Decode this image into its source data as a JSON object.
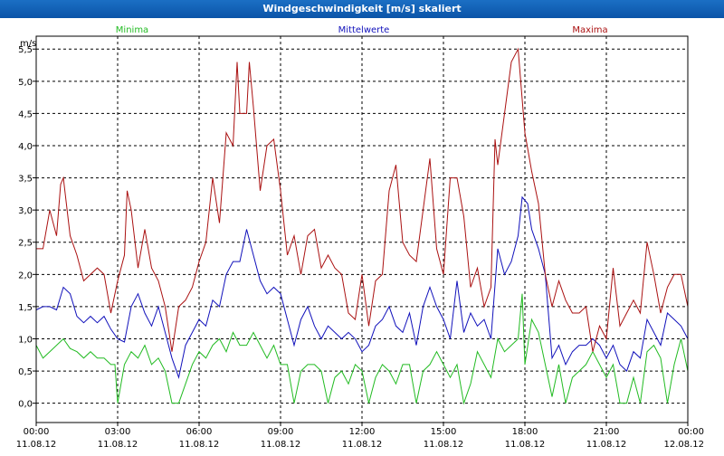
{
  "window": {
    "title": "Windgeschwindigkeit [m/s] skaliert"
  },
  "chart_data": {
    "type": "line",
    "title": "Windgeschwindigkeit [m/s] skaliert",
    "ylabel": "m/s",
    "xlabel": "",
    "ylim": [
      -0.3,
      5.7
    ],
    "xlim": [
      0,
      24
    ],
    "grid": true,
    "y_ticks": [
      0.0,
      0.5,
      1.0,
      1.5,
      2.0,
      2.5,
      3.0,
      3.5,
      4.0,
      4.5,
      5.0,
      5.5
    ],
    "y_tick_labels": [
      "0,0",
      "0,5",
      "1,0",
      "1,5",
      "2,0",
      "2,5",
      "3,0",
      "3,5",
      "4,0",
      "4,5",
      "5,0",
      "5,5"
    ],
    "x_ticks": [
      {
        "x": 0,
        "time": "00:00",
        "date": "11.08.12"
      },
      {
        "x": 3,
        "time": "03:00",
        "date": "11.08.12"
      },
      {
        "x": 6,
        "time": "06:00",
        "date": "11.08.12"
      },
      {
        "x": 9,
        "time": "09:00",
        "date": "11.08.12"
      },
      {
        "x": 12,
        "time": "12:00",
        "date": "11.08.12"
      },
      {
        "x": 15,
        "time": "15:00",
        "date": "11.08.12"
      },
      {
        "x": 18,
        "time": "18:00",
        "date": "11.08.12"
      },
      {
        "x": 21,
        "time": "21:00",
        "date": "11.08.12"
      },
      {
        "x": 24,
        "time": "00:00",
        "date": "12.08.12"
      }
    ],
    "series": [
      {
        "name": "Minima",
        "color": "#22bb22",
        "points": [
          [
            0,
            0.9
          ],
          [
            0.25,
            0.7
          ],
          [
            0.5,
            0.8
          ],
          [
            0.75,
            0.9
          ],
          [
            1.0,
            1.0
          ],
          [
            1.25,
            0.85
          ],
          [
            1.5,
            0.8
          ],
          [
            1.75,
            0.7
          ],
          [
            2.0,
            0.8
          ],
          [
            2.25,
            0.7
          ],
          [
            2.5,
            0.7
          ],
          [
            2.75,
            0.6
          ],
          [
            2.9,
            0.6
          ],
          [
            3.0,
            0.0
          ],
          [
            3.25,
            0.6
          ],
          [
            3.5,
            0.8
          ],
          [
            3.75,
            0.7
          ],
          [
            4.0,
            0.9
          ],
          [
            4.25,
            0.6
          ],
          [
            4.5,
            0.7
          ],
          [
            4.75,
            0.5
          ],
          [
            5.0,
            0.0
          ],
          [
            5.25,
            0.0
          ],
          [
            5.5,
            0.3
          ],
          [
            5.75,
            0.6
          ],
          [
            6.0,
            0.8
          ],
          [
            6.25,
            0.7
          ],
          [
            6.5,
            0.9
          ],
          [
            6.75,
            1.0
          ],
          [
            7.0,
            0.8
          ],
          [
            7.25,
            1.1
          ],
          [
            7.5,
            0.9
          ],
          [
            7.75,
            0.9
          ],
          [
            8.0,
            1.1
          ],
          [
            8.25,
            0.9
          ],
          [
            8.5,
            0.7
          ],
          [
            8.75,
            0.9
          ],
          [
            9.0,
            0.6
          ],
          [
            9.25,
            0.6
          ],
          [
            9.5,
            0.0
          ],
          [
            9.75,
            0.5
          ],
          [
            10.0,
            0.6
          ],
          [
            10.25,
            0.6
          ],
          [
            10.5,
            0.5
          ],
          [
            10.75,
            0.0
          ],
          [
            11.0,
            0.4
          ],
          [
            11.25,
            0.5
          ],
          [
            11.5,
            0.3
          ],
          [
            11.75,
            0.6
          ],
          [
            12.0,
            0.5
          ],
          [
            12.25,
            0.0
          ],
          [
            12.5,
            0.4
          ],
          [
            12.75,
            0.6
          ],
          [
            13.0,
            0.5
          ],
          [
            13.25,
            0.3
          ],
          [
            13.5,
            0.6
          ],
          [
            13.75,
            0.6
          ],
          [
            14.0,
            0.0
          ],
          [
            14.25,
            0.5
          ],
          [
            14.5,
            0.6
          ],
          [
            14.75,
            0.8
          ],
          [
            15.0,
            0.6
          ],
          [
            15.25,
            0.4
          ],
          [
            15.5,
            0.6
          ],
          [
            15.75,
            0.0
          ],
          [
            16.0,
            0.3
          ],
          [
            16.25,
            0.8
          ],
          [
            16.5,
            0.6
          ],
          [
            16.75,
            0.4
          ],
          [
            17.0,
            1.0
          ],
          [
            17.25,
            0.8
          ],
          [
            17.5,
            0.9
          ],
          [
            17.75,
            1.0
          ],
          [
            17.9,
            1.7
          ],
          [
            18.0,
            0.6
          ],
          [
            18.25,
            1.3
          ],
          [
            18.5,
            1.1
          ],
          [
            18.75,
            0.6
          ],
          [
            19.0,
            0.1
          ],
          [
            19.25,
            0.6
          ],
          [
            19.5,
            0.0
          ],
          [
            19.75,
            0.4
          ],
          [
            20.0,
            0.5
          ],
          [
            20.25,
            0.6
          ],
          [
            20.5,
            0.8
          ],
          [
            20.75,
            0.6
          ],
          [
            21.0,
            0.4
          ],
          [
            21.25,
            0.6
          ],
          [
            21.5,
            0.0
          ],
          [
            21.75,
            0.0
          ],
          [
            22.0,
            0.4
          ],
          [
            22.25,
            0.0
          ],
          [
            22.5,
            0.8
          ],
          [
            22.75,
            0.9
          ],
          [
            23.0,
            0.7
          ],
          [
            23.25,
            0.0
          ],
          [
            23.5,
            0.6
          ],
          [
            23.75,
            1.0
          ],
          [
            24.0,
            0.5
          ]
        ]
      },
      {
        "name": "Mittelwerte",
        "color": "#1111bb",
        "points": [
          [
            0,
            1.45
          ],
          [
            0.25,
            1.5
          ],
          [
            0.5,
            1.5
          ],
          [
            0.75,
            1.45
          ],
          [
            1.0,
            1.8
          ],
          [
            1.25,
            1.7
          ],
          [
            1.5,
            1.35
          ],
          [
            1.75,
            1.25
          ],
          [
            2.0,
            1.35
          ],
          [
            2.25,
            1.25
          ],
          [
            2.5,
            1.35
          ],
          [
            2.75,
            1.15
          ],
          [
            3.0,
            1.0
          ],
          [
            3.25,
            0.95
          ],
          [
            3.5,
            1.5
          ],
          [
            3.75,
            1.7
          ],
          [
            4.0,
            1.4
          ],
          [
            4.25,
            1.2
          ],
          [
            4.5,
            1.5
          ],
          [
            4.75,
            1.1
          ],
          [
            5.0,
            0.7
          ],
          [
            5.25,
            0.4
          ],
          [
            5.5,
            0.9
          ],
          [
            5.75,
            1.1
          ],
          [
            6.0,
            1.3
          ],
          [
            6.25,
            1.2
          ],
          [
            6.5,
            1.6
          ],
          [
            6.75,
            1.5
          ],
          [
            7.0,
            2.0
          ],
          [
            7.25,
            2.2
          ],
          [
            7.5,
            2.2
          ],
          [
            7.75,
            2.7
          ],
          [
            8.0,
            2.3
          ],
          [
            8.25,
            1.9
          ],
          [
            8.5,
            1.7
          ],
          [
            8.75,
            1.8
          ],
          [
            9.0,
            1.7
          ],
          [
            9.25,
            1.3
          ],
          [
            9.5,
            0.9
          ],
          [
            9.75,
            1.3
          ],
          [
            10.0,
            1.5
          ],
          [
            10.25,
            1.2
          ],
          [
            10.5,
            1.0
          ],
          [
            10.75,
            1.2
          ],
          [
            11.0,
            1.1
          ],
          [
            11.25,
            1.0
          ],
          [
            11.5,
            1.1
          ],
          [
            11.75,
            1.0
          ],
          [
            12.0,
            0.8
          ],
          [
            12.25,
            0.9
          ],
          [
            12.5,
            1.2
          ],
          [
            12.75,
            1.3
          ],
          [
            13.0,
            1.5
          ],
          [
            13.25,
            1.2
          ],
          [
            13.5,
            1.1
          ],
          [
            13.75,
            1.4
          ],
          [
            14.0,
            0.9
          ],
          [
            14.25,
            1.5
          ],
          [
            14.5,
            1.8
          ],
          [
            14.75,
            1.5
          ],
          [
            15.0,
            1.3
          ],
          [
            15.25,
            1.0
          ],
          [
            15.5,
            1.9
          ],
          [
            15.75,
            1.1
          ],
          [
            16.0,
            1.4
          ],
          [
            16.25,
            1.2
          ],
          [
            16.5,
            1.3
          ],
          [
            16.75,
            1.0
          ],
          [
            17.0,
            2.4
          ],
          [
            17.25,
            2.0
          ],
          [
            17.5,
            2.2
          ],
          [
            17.75,
            2.6
          ],
          [
            17.9,
            3.2
          ],
          [
            18.1,
            3.1
          ],
          [
            18.25,
            2.7
          ],
          [
            18.5,
            2.4
          ],
          [
            18.75,
            2.0
          ],
          [
            19.0,
            0.7
          ],
          [
            19.25,
            0.9
          ],
          [
            19.5,
            0.6
          ],
          [
            19.75,
            0.8
          ],
          [
            20.0,
            0.9
          ],
          [
            20.25,
            0.9
          ],
          [
            20.5,
            1.0
          ],
          [
            20.75,
            0.9
          ],
          [
            21.0,
            0.7
          ],
          [
            21.25,
            0.9
          ],
          [
            21.5,
            0.6
          ],
          [
            21.75,
            0.5
          ],
          [
            22.0,
            0.8
          ],
          [
            22.25,
            0.7
          ],
          [
            22.5,
            1.3
          ],
          [
            22.75,
            1.1
          ],
          [
            23.0,
            0.9
          ],
          [
            23.25,
            1.4
          ],
          [
            23.5,
            1.3
          ],
          [
            23.75,
            1.2
          ],
          [
            24.0,
            1.0
          ]
        ]
      },
      {
        "name": "Maxima",
        "color": "#aa1111",
        "points": [
          [
            0,
            2.4
          ],
          [
            0.25,
            2.4
          ],
          [
            0.5,
            3.0
          ],
          [
            0.75,
            2.6
          ],
          [
            0.9,
            3.4
          ],
          [
            1.0,
            3.5
          ],
          [
            1.25,
            2.6
          ],
          [
            1.5,
            2.3
          ],
          [
            1.75,
            1.9
          ],
          [
            2.0,
            2.0
          ],
          [
            2.25,
            2.1
          ],
          [
            2.5,
            2.0
          ],
          [
            2.75,
            1.4
          ],
          [
            3.0,
            1.9
          ],
          [
            3.25,
            2.3
          ],
          [
            3.35,
            3.3
          ],
          [
            3.5,
            3.0
          ],
          [
            3.75,
            2.1
          ],
          [
            4.0,
            2.7
          ],
          [
            4.25,
            2.1
          ],
          [
            4.5,
            1.9
          ],
          [
            4.75,
            1.5
          ],
          [
            5.0,
            0.8
          ],
          [
            5.25,
            1.5
          ],
          [
            5.5,
            1.6
          ],
          [
            5.75,
            1.8
          ],
          [
            6.0,
            2.2
          ],
          [
            6.25,
            2.5
          ],
          [
            6.5,
            3.5
          ],
          [
            6.75,
            2.8
          ],
          [
            7.0,
            4.2
          ],
          [
            7.25,
            4.0
          ],
          [
            7.4,
            5.3
          ],
          [
            7.5,
            4.5
          ],
          [
            7.75,
            4.5
          ],
          [
            7.85,
            5.3
          ],
          [
            8.0,
            4.6
          ],
          [
            8.25,
            3.3
          ],
          [
            8.5,
            4.0
          ],
          [
            8.75,
            4.1
          ],
          [
            9.0,
            3.3
          ],
          [
            9.25,
            2.3
          ],
          [
            9.5,
            2.6
          ],
          [
            9.75,
            2.0
          ],
          [
            10.0,
            2.6
          ],
          [
            10.25,
            2.7
          ],
          [
            10.5,
            2.1
          ],
          [
            10.75,
            2.3
          ],
          [
            11.0,
            2.1
          ],
          [
            11.25,
            2.0
          ],
          [
            11.5,
            1.4
          ],
          [
            11.75,
            1.3
          ],
          [
            12.0,
            2.0
          ],
          [
            12.25,
            1.2
          ],
          [
            12.5,
            1.9
          ],
          [
            12.75,
            2.0
          ],
          [
            13.0,
            3.3
          ],
          [
            13.25,
            3.7
          ],
          [
            13.5,
            2.5
          ],
          [
            13.75,
            2.3
          ],
          [
            14.0,
            2.2
          ],
          [
            14.25,
            3.0
          ],
          [
            14.5,
            3.8
          ],
          [
            14.75,
            2.4
          ],
          [
            15.0,
            2.0
          ],
          [
            15.25,
            3.5
          ],
          [
            15.5,
            3.5
          ],
          [
            15.75,
            2.9
          ],
          [
            16.0,
            1.8
          ],
          [
            16.25,
            2.1
          ],
          [
            16.5,
            1.5
          ],
          [
            16.75,
            1.8
          ],
          [
            16.9,
            4.1
          ],
          [
            17.0,
            3.7
          ],
          [
            17.25,
            4.5
          ],
          [
            17.5,
            5.3
          ],
          [
            17.75,
            5.5
          ],
          [
            18.0,
            4.2
          ],
          [
            18.25,
            3.6
          ],
          [
            18.5,
            3.1
          ],
          [
            18.75,
            2.0
          ],
          [
            19.0,
            1.5
          ],
          [
            19.25,
            1.9
          ],
          [
            19.5,
            1.6
          ],
          [
            19.75,
            1.4
          ],
          [
            20.0,
            1.4
          ],
          [
            20.25,
            1.5
          ],
          [
            20.5,
            0.8
          ],
          [
            20.75,
            1.2
          ],
          [
            21.0,
            1.0
          ],
          [
            21.25,
            2.1
          ],
          [
            21.5,
            1.2
          ],
          [
            21.75,
            1.4
          ],
          [
            22.0,
            1.6
          ],
          [
            22.25,
            1.4
          ],
          [
            22.5,
            2.5
          ],
          [
            22.75,
            2.0
          ],
          [
            23.0,
            1.4
          ],
          [
            23.25,
            1.8
          ],
          [
            23.5,
            2.0
          ],
          [
            23.75,
            2.0
          ],
          [
            24.0,
            1.5
          ]
        ]
      }
    ],
    "legend": "top"
  }
}
